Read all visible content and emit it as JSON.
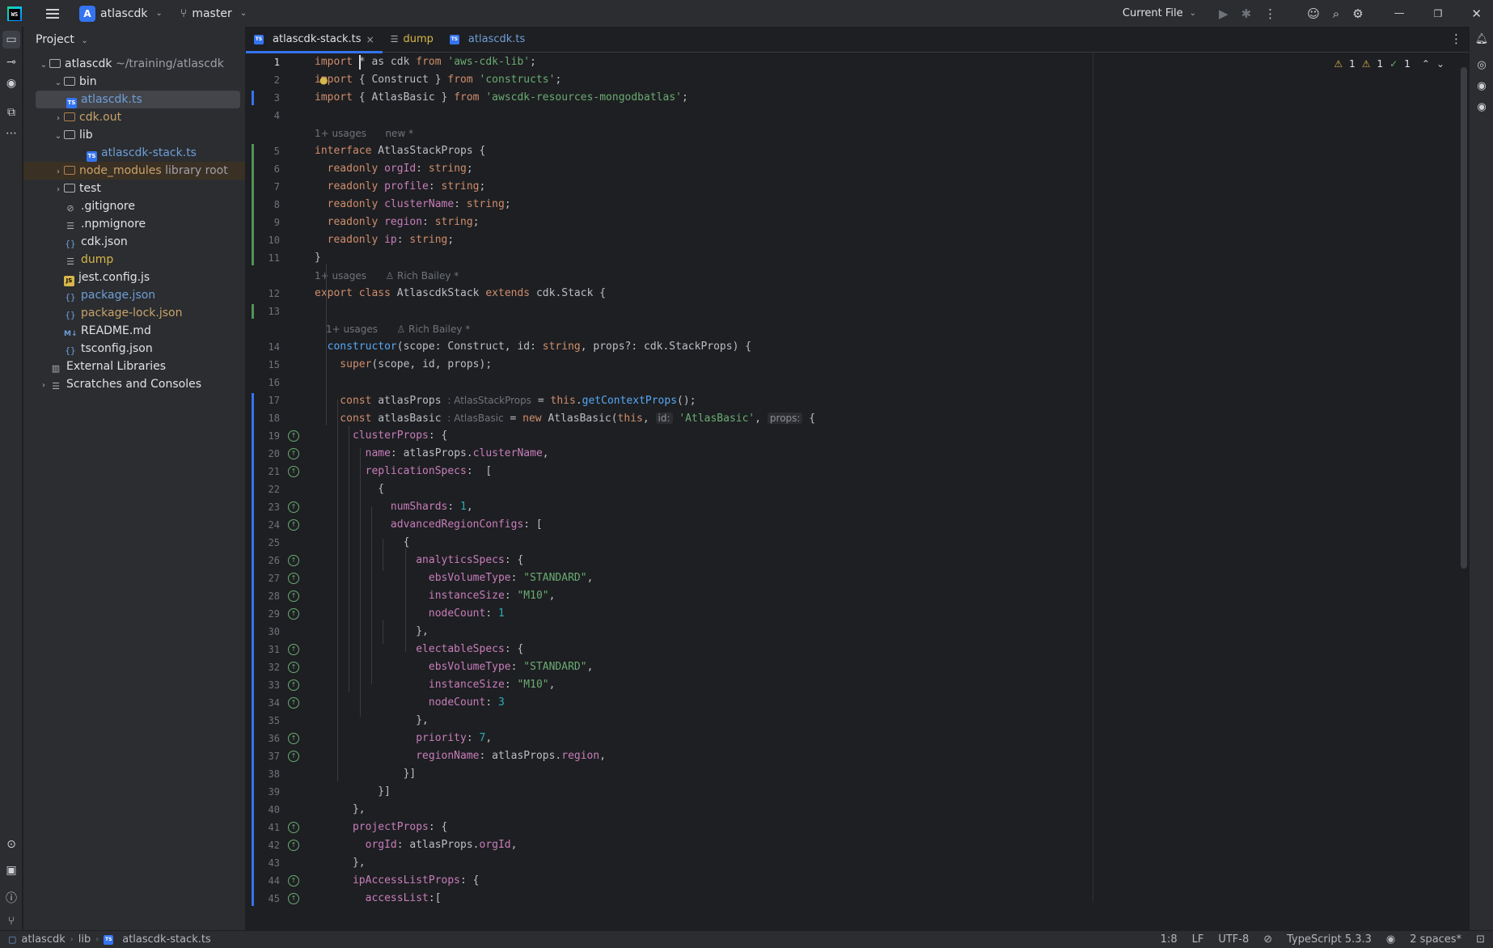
{
  "titlebar": {
    "project_badge": "A",
    "project_name": "atlascdk",
    "branch": "master",
    "run_config": "Current File"
  },
  "project_panel": {
    "header": "Project",
    "tree": [
      {
        "label": "atlascdk",
        "suffix": "~/training/atlascdk",
        "kind": "folder",
        "depth": 0,
        "arrow": "open"
      },
      {
        "label": "bin",
        "kind": "folder",
        "depth": 1,
        "arrow": "open"
      },
      {
        "label": "atlascdk.ts",
        "kind": "ts",
        "depth": 2,
        "selected": true
      },
      {
        "label": "cdk.out",
        "kind": "folder-orange",
        "depth": 1,
        "arrow": "closed"
      },
      {
        "label": "lib",
        "kind": "folder",
        "depth": 1,
        "arrow": "open"
      },
      {
        "label": "atlascdk-stack.ts",
        "kind": "ts",
        "depth": 2
      },
      {
        "label": "node_modules",
        "suffix": "library root",
        "kind": "folder-orange",
        "depth": 1,
        "arrow": "closed",
        "excluded": true
      },
      {
        "label": "test",
        "kind": "folder",
        "depth": 1,
        "arrow": "closed"
      },
      {
        "label": ".gitignore",
        "kind": "ignore",
        "depth": 1
      },
      {
        "label": ".npmignore",
        "kind": "text",
        "depth": 1
      },
      {
        "label": "cdk.json",
        "kind": "json",
        "depth": 1
      },
      {
        "label": "dump",
        "kind": "text-green",
        "depth": 1
      },
      {
        "label": "jest.config.js",
        "kind": "js",
        "depth": 1
      },
      {
        "label": "package.json",
        "kind": "json-blue",
        "depth": 1
      },
      {
        "label": "package-lock.json",
        "kind": "json-orange",
        "depth": 1
      },
      {
        "label": "README.md",
        "kind": "md",
        "depth": 1
      },
      {
        "label": "tsconfig.json",
        "kind": "json",
        "depth": 1
      },
      {
        "label": "External Libraries",
        "kind": "lib",
        "depth": 0
      },
      {
        "label": "Scratches and Consoles",
        "kind": "scratch",
        "depth": 0,
        "arrow": "closed"
      }
    ]
  },
  "tabs": [
    {
      "label": "atlascdk-stack.ts",
      "icon": "TS",
      "active": true,
      "close": "×"
    },
    {
      "label": "dump",
      "icon": "text"
    },
    {
      "label": "atlascdk.ts",
      "icon": "TS"
    }
  ],
  "inspections": {
    "warn1": "1",
    "warn2": "1",
    "ok": "1"
  },
  "hints": {
    "usages": "1+ usages",
    "new": "new *",
    "author": "Rich Bailey *",
    "inlay_type_props": ": AtlasStackProps",
    "inlay_type_basic": ": AtlasBasic",
    "inlay_id": "id:",
    "inlay_props": "props:"
  },
  "line_numbers": [
    "1",
    "2",
    "3",
    "4",
    "5",
    "6",
    "7",
    "8",
    "9",
    "10",
    "11",
    "12",
    "13",
    "14",
    "15",
    "16",
    "17",
    "18",
    "19",
    "20",
    "21",
    "22",
    "23",
    "24",
    "25",
    "26",
    "27",
    "28",
    "29",
    "30",
    "31",
    "32",
    "33",
    "34",
    "35",
    "36",
    "37",
    "38",
    "39",
    "40",
    "41",
    "42",
    "43",
    "44",
    "45"
  ],
  "code": {
    "l1": [
      "import ",
      "* as cdk ",
      "from ",
      "'aws-cdk-lib'",
      ";"
    ],
    "l2": [
      "import ",
      "{ Construct } ",
      "from ",
      "'constructs'",
      ";"
    ],
    "l3": [
      "import ",
      "{ AtlasBasic } ",
      "from ",
      "'awscdk-resources-mongodbatlas'",
      ";"
    ],
    "l5": [
      "interface ",
      "AtlasStackProps {"
    ],
    "l6": [
      "  readonly ",
      "orgId",
      ": ",
      "string",
      ";"
    ],
    "l7": [
      "  readonly ",
      "profile",
      ": ",
      "string",
      ";"
    ],
    "l8": [
      "  readonly ",
      "clusterName",
      ": ",
      "string",
      ";"
    ],
    "l9": [
      "  readonly ",
      "region",
      ": ",
      "string",
      ";"
    ],
    "l10": [
      "  readonly ",
      "ip",
      ": ",
      "string",
      ";"
    ],
    "l11": "}",
    "l12": [
      "export ",
      "class ",
      "AtlascdkStack ",
      "extends ",
      "cdk.Stack {"
    ],
    "l14": [
      "  constructor",
      "(scope: Construct, id: ",
      "string",
      ", props?: cdk.StackProps) {"
    ],
    "l15": [
      "    super",
      "(scope, id, props);"
    ],
    "l17": [
      "    const ",
      "atlasProps ",
      " = ",
      "this",
      ".",
      "getContextProps",
      "();"
    ],
    "l18": [
      "    const ",
      "atlasBasic ",
      " = ",
      "new ",
      "AtlasBasic(",
      "this",
      ", ",
      "'AtlasBasic'",
      ", ",
      "{"
    ],
    "l19": [
      "      clusterProps",
      ": {"
    ],
    "l20": [
      "        name",
      ": atlasProps.",
      "clusterName",
      ","
    ],
    "l21": [
      "        replicationSpecs",
      ":  ["
    ],
    "l22": "          {",
    "l23": [
      "            numShards",
      ": ",
      "1",
      ","
    ],
    "l24": [
      "            advancedRegionConfigs",
      ": ["
    ],
    "l25": "              {",
    "l26": [
      "                analyticsSpecs",
      ": {"
    ],
    "l27": [
      "                  ebsVolumeType",
      ": ",
      "\"STANDARD\"",
      ","
    ],
    "l28": [
      "                  instanceSize",
      ": ",
      "\"M10\"",
      ","
    ],
    "l29": [
      "                  nodeCount",
      ": ",
      "1"
    ],
    "l30": "                },",
    "l31": [
      "                electableSpecs",
      ": {"
    ],
    "l32": [
      "                  ebsVolumeType",
      ": ",
      "\"STANDARD\"",
      ","
    ],
    "l33": [
      "                  instanceSize",
      ": ",
      "\"M10\"",
      ","
    ],
    "l34": [
      "                  nodeCount",
      ": ",
      "3"
    ],
    "l35": "                },",
    "l36": [
      "                priority",
      ": ",
      "7",
      ","
    ],
    "l37": [
      "                regionName",
      ": atlasProps.",
      "region",
      ","
    ],
    "l38": "              }]",
    "l39": "          }]",
    "l40": "      },",
    "l41": [
      "      projectProps",
      ": {"
    ],
    "l42": [
      "        orgId",
      ": atlasProps.",
      "orgId",
      ","
    ],
    "l43": "      },",
    "l44": [
      "      ipAccessListProps",
      ": {"
    ],
    "l45": [
      "        accessList",
      ":["
    ]
  },
  "statusbar": {
    "crumbs": [
      "atlascdk",
      "lib",
      "atlascdk-stack.ts"
    ],
    "position": "1:8",
    "line_sep": "LF",
    "encoding": "UTF-8",
    "language": "TypeScript 5.3.3",
    "indent": "2 spaces*"
  },
  "colors": {
    "accent": "#3574f0",
    "keyword": "#cf8e6d",
    "string": "#6aab73",
    "number": "#2aacb8",
    "property": "#c77dbb",
    "function": "#56a8f5"
  }
}
